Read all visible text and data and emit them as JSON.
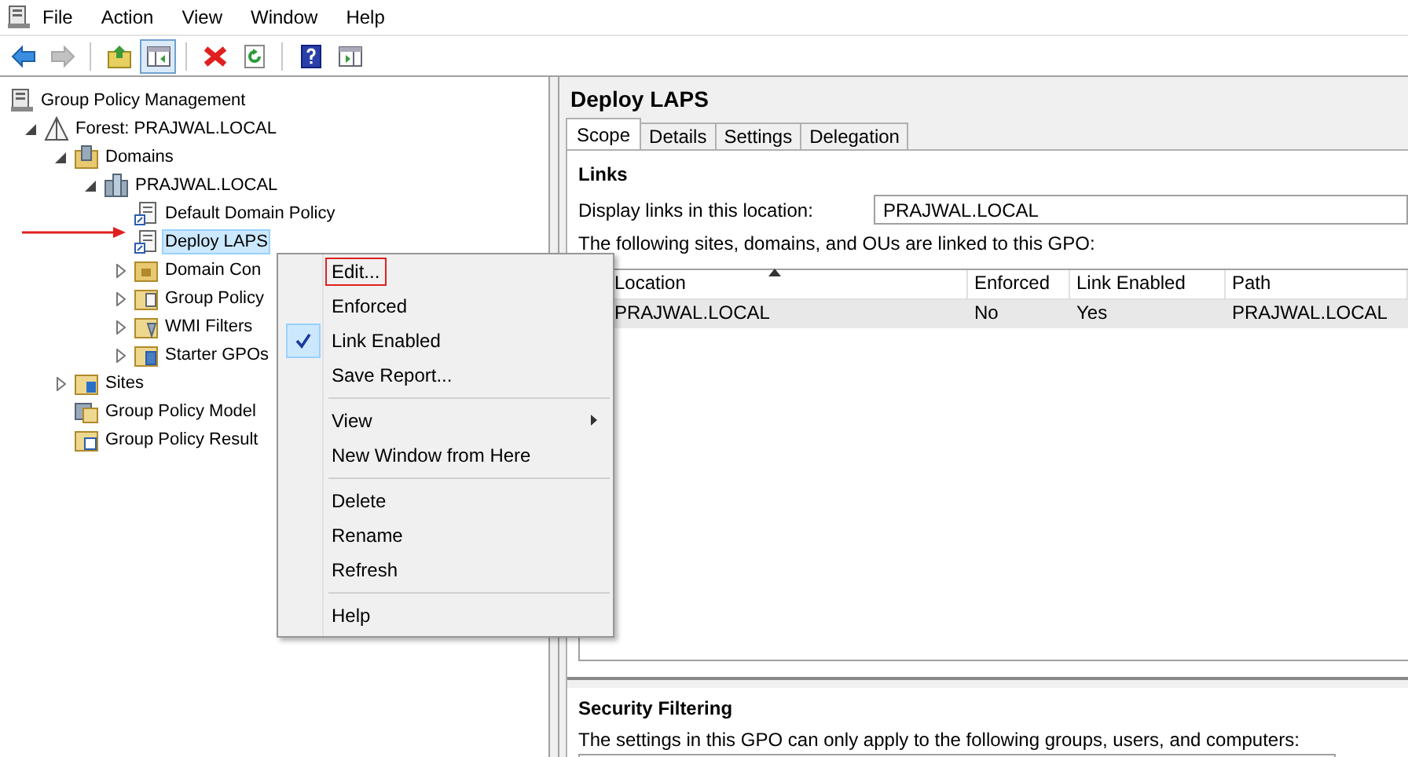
{
  "menubar": [
    "File",
    "Action",
    "View",
    "Window",
    "Help"
  ],
  "toolbar": [
    {
      "kind": "back",
      "disabled": false,
      "pressed": false
    },
    {
      "kind": "forward",
      "disabled": true,
      "pressed": false
    },
    {
      "kind": "separator"
    },
    {
      "kind": "up",
      "disabled": false,
      "pressed": false
    },
    {
      "kind": "tree-toggle",
      "disabled": false,
      "pressed": true
    },
    {
      "kind": "separator"
    },
    {
      "kind": "delete",
      "disabled": false,
      "pressed": false
    },
    {
      "kind": "refresh",
      "disabled": false,
      "pressed": false
    },
    {
      "kind": "separator"
    },
    {
      "kind": "help",
      "disabled": false,
      "pressed": false
    },
    {
      "kind": "action-toggle",
      "disabled": false,
      "pressed": false
    }
  ],
  "tree": {
    "label": "Group Policy Management",
    "kind": "console",
    "selected": false,
    "children": [
      {
        "label": "Forest: PRAJWAL.LOCAL",
        "kind": "forest",
        "selected": false,
        "expanded": true,
        "children": [
          {
            "label": "Domains",
            "kind": "domains",
            "selected": false,
            "expanded": true,
            "children": [
              {
                "label": "PRAJWAL.LOCAL",
                "kind": "domain",
                "selected": false,
                "expanded": true,
                "children": [
                  {
                    "label": "Default Domain Policy",
                    "kind": "gpo",
                    "selected": false
                  },
                  {
                    "label": "Deploy LAPS",
                    "kind": "gpo",
                    "selected": true
                  },
                  {
                    "label": "Domain Con",
                    "kind": "ou",
                    "selected": false,
                    "expanded": false
                  },
                  {
                    "label": "Group Policy",
                    "kind": "gpo-folder",
                    "selected": false,
                    "expanded": false
                  },
                  {
                    "label": "WMI Filters",
                    "kind": "wmi",
                    "selected": false,
                    "expanded": false
                  },
                  {
                    "label": "Starter GPOs",
                    "kind": "starter",
                    "selected": false,
                    "expanded": false
                  }
                ]
              }
            ]
          },
          {
            "label": "Sites",
            "kind": "sites",
            "selected": false,
            "expanded": false
          },
          {
            "label": "Group Policy Model",
            "kind": "modeling",
            "selected": false
          },
          {
            "label": "Group Policy Result",
            "kind": "results",
            "selected": false
          }
        ]
      }
    ]
  },
  "details": {
    "title": "Deploy LAPS",
    "tabs": [
      {
        "label": "Scope",
        "selected": true
      },
      {
        "label": "Details",
        "selected": false
      },
      {
        "label": "Settings",
        "selected": false
      },
      {
        "label": "Delegation",
        "selected": false
      }
    ],
    "links": {
      "heading": "Links",
      "location_label": "Display links in this location:",
      "location_value": "PRAJWAL.LOCAL",
      "description": "The following sites, domains, and OUs are linked to this GPO:",
      "columns": [
        {
          "label": "Location",
          "sorted": true
        },
        {
          "label": "Enforced",
          "sorted": false
        },
        {
          "label": "Link Enabled",
          "sorted": false
        },
        {
          "label": "Path",
          "sorted": false
        }
      ],
      "rows": [
        [
          "PRAJWAL.LOCAL",
          "No",
          "Yes",
          "PRAJWAL.LOCAL"
        ]
      ]
    },
    "security_filtering": {
      "heading": "Security Filtering",
      "description": "The settings in this GPO can only apply to the following groups, users, and computers:"
    }
  },
  "context_menu": [
    {
      "kind": "item",
      "label": "Edit...",
      "checked": false,
      "outlined": true,
      "submenu": false
    },
    {
      "kind": "item",
      "label": "Enforced",
      "checked": false,
      "outlined": false,
      "submenu": false
    },
    {
      "kind": "item",
      "label": "Link Enabled",
      "checked": true,
      "outlined": false,
      "submenu": false
    },
    {
      "kind": "item",
      "label": "Save Report...",
      "checked": false,
      "outlined": false,
      "submenu": false
    },
    {
      "kind": "separator"
    },
    {
      "kind": "item",
      "label": "View",
      "checked": false,
      "outlined": false,
      "submenu": true
    },
    {
      "kind": "item",
      "label": "New Window from Here",
      "checked": false,
      "outlined": false,
      "submenu": false
    },
    {
      "kind": "separator"
    },
    {
      "kind": "item",
      "label": "Delete",
      "checked": false,
      "outlined": false,
      "submenu": false
    },
    {
      "kind": "item",
      "label": "Rename",
      "checked": false,
      "outlined": false,
      "submenu": false
    },
    {
      "kind": "item",
      "label": "Refresh",
      "checked": false,
      "outlined": false,
      "submenu": false
    },
    {
      "kind": "separator"
    },
    {
      "kind": "item",
      "label": "Help",
      "checked": false,
      "outlined": false,
      "submenu": false
    }
  ]
}
